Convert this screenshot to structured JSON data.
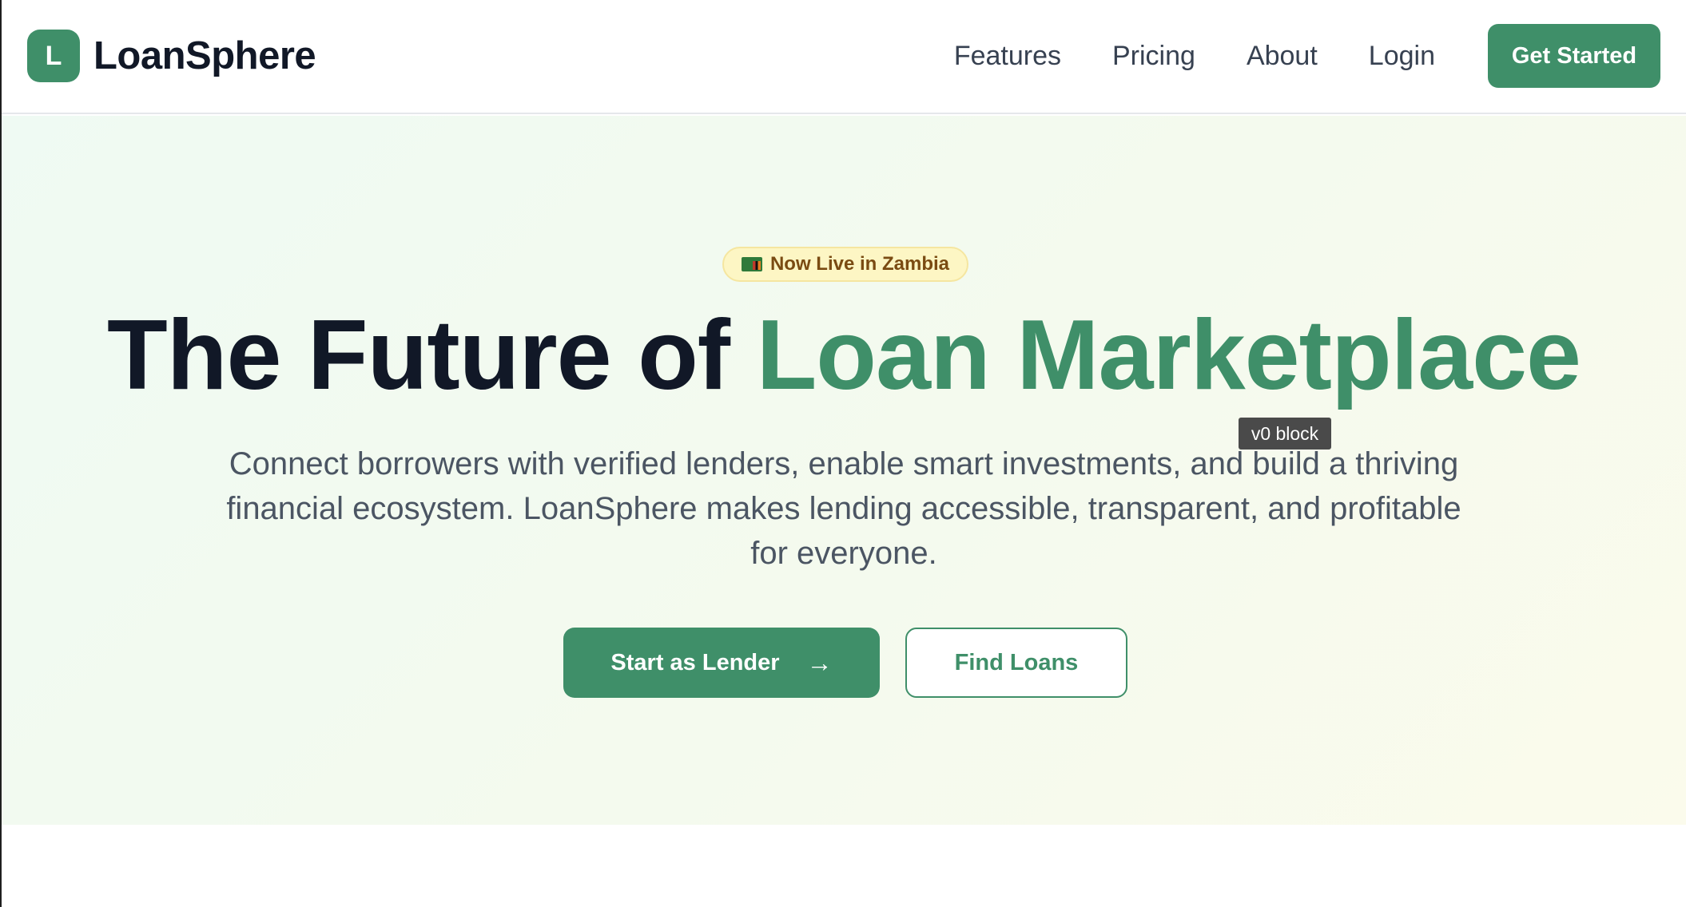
{
  "brand": {
    "logo_letter": "L",
    "name": "LoanSphere"
  },
  "nav": {
    "links": [
      "Features",
      "Pricing",
      "About",
      "Login"
    ],
    "cta_label": "Get Started"
  },
  "hero": {
    "badge_text": "Now Live in Zambia",
    "headline_dark": "The Future of ",
    "headline_accent": "Loan Marketplace",
    "subtext": "Connect borrowers with verified lenders, enable smart investments, and build a thriving financial ecosystem. LoanSphere makes lending accessible, transparent, and profitable for everyone.",
    "primary_button_label": "Start as Lender",
    "secondary_button_label": "Find Loans"
  },
  "tooltip": {
    "text": "v0 block"
  },
  "colors": {
    "brand_green": "#3f8f69",
    "heading_dark": "#111827",
    "badge_bg": "#fdf6c4",
    "badge_text": "#7a4b12"
  },
  "icons": {
    "badge": "zambia-flag-icon",
    "primary_button": "arrow-right-icon"
  }
}
